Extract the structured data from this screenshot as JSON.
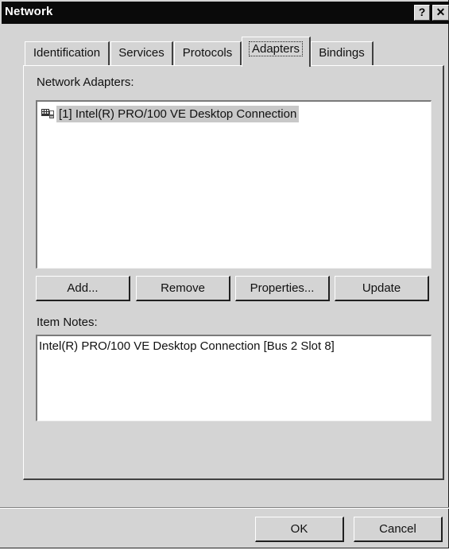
{
  "window": {
    "title": "Network",
    "help_label": "?",
    "close_label": "✕"
  },
  "tabs": [
    {
      "label": "Identification"
    },
    {
      "label": "Services"
    },
    {
      "label": "Protocols"
    },
    {
      "label": "Adapters",
      "active": true
    },
    {
      "label": "Bindings"
    }
  ],
  "adapters": {
    "label": "Network Adapters:",
    "items": [
      {
        "text": "[1] Intel(R) PRO/100 VE Desktop Connection",
        "icon": "network-adapter-icon",
        "selected": true
      }
    ]
  },
  "buttons": {
    "add": "Add...",
    "remove": "Remove",
    "properties": "Properties...",
    "update": "Update"
  },
  "notes": {
    "label": "Item Notes:",
    "text": "Intel(R) PRO/100 VE Desktop Connection [Bus 2 Slot 8]"
  },
  "footer": {
    "ok": "OK",
    "cancel": "Cancel"
  }
}
